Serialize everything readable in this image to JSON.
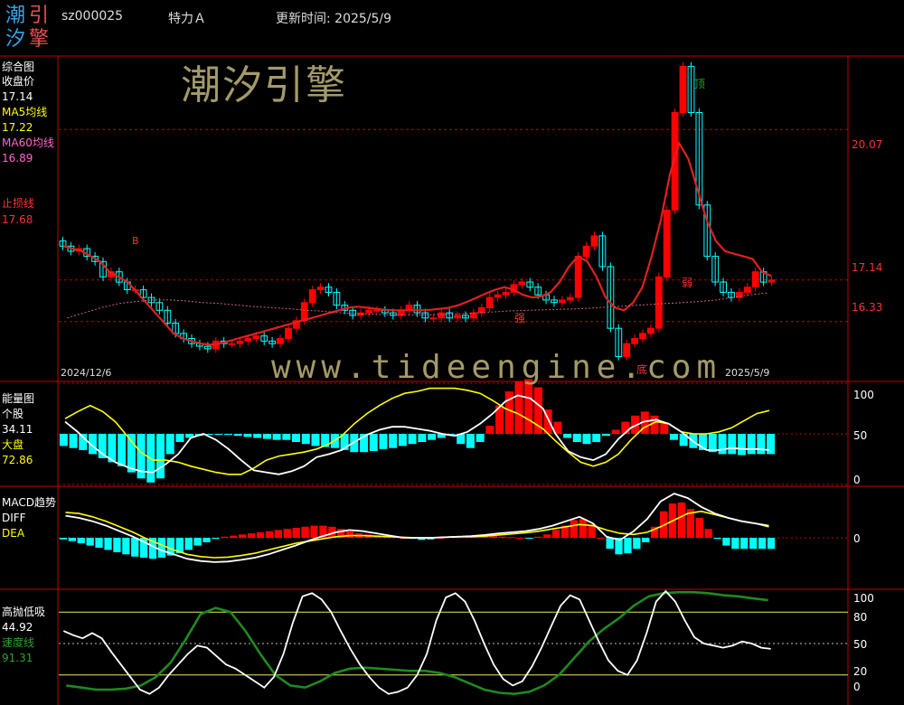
{
  "header": {
    "logo": [
      "潮",
      "引",
      "汐",
      "擎"
    ],
    "code": "sz000025",
    "name": "特力Ａ",
    "update_label": "更新时间: 2025/5/9"
  },
  "watermark": {
    "cn": "潮汐引擎",
    "url": "www.tideengine.com"
  },
  "colors": {
    "up": "#ff0000",
    "down": "#00ffff",
    "yellow": "#ffff00",
    "magenta": "#ff66cc",
    "green": "#1f8a1f",
    "axis_red": "#ff3030"
  },
  "panel1": {
    "title": "综合图",
    "close_label": "收盘价",
    "close_value": "17.14",
    "ma5_label": "MA5均线",
    "ma5_value": "17.22",
    "ma60_label": "MA60均线",
    "ma60_value": "16.89",
    "stop_label": "止损线",
    "stop_value": "17.68",
    "ticks": [
      "20.07",
      "17.14",
      "16.33"
    ],
    "date_start": "2024/12/6",
    "date_end": "2025/5/9",
    "mark_top": "顶",
    "mark_bottom": "底",
    "mark_strong": "强",
    "mark_weak": "弱",
    "mark_b": "B"
  },
  "panel2": {
    "title": "能量图",
    "stock_label": "个股",
    "stock_value": "34.11",
    "market_label": "大盘",
    "market_value": "72.86",
    "ticks": [
      "100",
      "50",
      "0"
    ]
  },
  "panel3": {
    "title": "MACD趋势",
    "diff_label": "DIFF",
    "dea_label": "DEA",
    "ticks": [
      "0"
    ]
  },
  "panel4": {
    "title": "高抛低吸",
    "value": "44.92",
    "speed_label": "速度线",
    "speed_value": "91.31",
    "ticks": [
      "100",
      "80",
      "50",
      "20",
      "0"
    ]
  },
  "chart_data": [
    {
      "type": "candlestick",
      "title": "综合图",
      "x_start": "2024/12/6",
      "x_end": "2025/5/9",
      "ylim": [
        15.2,
        21.5
      ],
      "reference_lines": [
        20.07,
        17.14,
        16.33
      ],
      "close": [
        17.8,
        17.7,
        17.75,
        17.6,
        17.5,
        17.2,
        17.3,
        17.1,
        16.95,
        16.95,
        16.8,
        16.7,
        16.55,
        16.3,
        16.1,
        16.0,
        15.9,
        15.85,
        15.8,
        15.95,
        15.9,
        15.9,
        15.95,
        16.0,
        16.05,
        15.95,
        15.9,
        16.0,
        16.2,
        16.35,
        16.7,
        16.95,
        17.0,
        16.9,
        16.65,
        16.55,
        16.45,
        16.5,
        16.55,
        16.55,
        16.5,
        16.45,
        16.55,
        16.65,
        16.5,
        16.4,
        16.4,
        16.5,
        16.4,
        16.45,
        16.4,
        16.5,
        16.6,
        16.8,
        16.85,
        16.9,
        17.05,
        17.1,
        17.0,
        16.85,
        16.75,
        16.7,
        16.75,
        16.8,
        17.6,
        17.8,
        18.0,
        17.4,
        16.2,
        15.65,
        15.9,
        16.0,
        16.1,
        16.2,
        17.2,
        18.5,
        20.4,
        21.3,
        20.4,
        18.6,
        17.6,
        17.1,
        16.9,
        16.8,
        16.9,
        17.0,
        17.3,
        17.1,
        17.14
      ],
      "ma5": [
        17.8,
        17.75,
        17.7,
        17.6,
        17.5,
        17.3,
        17.2,
        17.1,
        16.9,
        16.7,
        16.5,
        16.3,
        16.1,
        16.0,
        15.95,
        15.9,
        15.88,
        15.9,
        15.95,
        16.0,
        16.05,
        16.1,
        16.15,
        16.2,
        16.25,
        16.3,
        16.35,
        16.4,
        16.45,
        16.5,
        16.55,
        16.6,
        16.62,
        16.6,
        16.58,
        16.56,
        16.55,
        16.55,
        16.55,
        16.55,
        16.56,
        16.58,
        16.6,
        16.65,
        16.72,
        16.8,
        16.88,
        16.95,
        17.0,
        16.95,
        16.85,
        16.8,
        16.82,
        16.9,
        17.1,
        17.4,
        17.6,
        17.5,
        17.2,
        16.8,
        16.6,
        16.55,
        16.7,
        17.0,
        17.6,
        18.3,
        19.2,
        19.8,
        19.5,
        18.9,
        18.3,
        17.9,
        17.7,
        17.65,
        17.6,
        17.55,
        17.3,
        17.22
      ],
      "ma60": [
        16.4,
        16.5,
        16.6,
        16.68,
        16.72,
        16.75,
        16.75,
        16.73,
        16.7,
        16.68,
        16.65,
        16.62,
        16.6,
        16.58,
        16.55,
        16.53,
        16.5,
        16.48,
        16.47,
        16.46,
        16.46,
        16.46,
        16.47,
        16.48,
        16.5,
        16.52,
        16.54,
        16.55,
        16.56,
        16.57,
        16.58,
        16.6,
        16.62,
        16.64,
        16.66,
        16.68,
        16.7,
        16.72,
        16.75,
        16.8,
        16.85,
        16.89
      ]
    },
    {
      "type": "line+bar",
      "title": "能量图",
      "ylim": [
        0,
        100
      ],
      "series": [
        {
          "name": "个股",
          "values": [
            62,
            52,
            40,
            30,
            22,
            17,
            13,
            12,
            20,
            30,
            46,
            50,
            44,
            35,
            24,
            14,
            12,
            10,
            13,
            18,
            27,
            30,
            34,
            42,
            49,
            54,
            57,
            57,
            55,
            53,
            50,
            48,
            52,
            60,
            70,
            82,
            88,
            85,
            75,
            50,
            33,
            27,
            24,
            30,
            45,
            56,
            62,
            64,
            60,
            52,
            42,
            34,
            34,
            36,
            35,
            35,
            34
          ]
        },
        {
          "name": "大盘",
          "values": [
            65,
            72,
            78,
            72,
            62,
            47,
            32,
            24,
            24,
            22,
            18,
            15,
            12,
            10,
            10,
            16,
            24,
            28,
            30,
            32,
            35,
            40,
            48,
            60,
            70,
            78,
            85,
            90,
            92,
            95,
            95,
            95,
            93,
            90,
            83,
            75,
            70,
            63,
            55,
            43,
            32,
            22,
            18,
            22,
            30,
            44,
            56,
            62,
            60,
            52,
            50,
            50,
            52,
            56,
            63,
            70,
            73
          ]
        }
      ],
      "bars": [
        -12,
        -14,
        -16,
        -20,
        -24,
        -28,
        -32,
        -38,
        -44,
        -48,
        -44,
        -20,
        -8,
        -4,
        -2,
        -1,
        -1,
        -1,
        -2,
        -3,
        -4,
        -5,
        -6,
        -6,
        -8,
        -10,
        -12,
        -13,
        -14,
        -16,
        -18,
        -18,
        -17,
        -15,
        -14,
        -12,
        -10,
        -8,
        -6,
        -4,
        -2,
        -10,
        -14,
        -8,
        8,
        28,
        42,
        52,
        54,
        46,
        24,
        12,
        -4,
        -8,
        -10,
        -8,
        -2,
        4,
        12,
        18,
        22,
        18,
        10,
        -6,
        -12,
        -14,
        -16,
        -18,
        -20,
        -20,
        -21,
        -20,
        -20,
        -20
      ]
    },
    {
      "type": "line+bar",
      "title": "MACD趋势",
      "ylim": [
        -0.9,
        0.9
      ],
      "series": [
        {
          "name": "DIFF",
          "values": [
            0.4,
            0.36,
            0.3,
            0.22,
            0.12,
            0.02,
            -0.1,
            -0.22,
            -0.3,
            -0.38,
            -0.42,
            -0.44,
            -0.43,
            -0.4,
            -0.36,
            -0.3,
            -0.22,
            -0.14,
            -0.05,
            0.03,
            0.1,
            0.14,
            0.12,
            0.08,
            0.04,
            0.0,
            0.0,
            0.0,
            0.01,
            0.02,
            0.03,
            0.05,
            0.08,
            0.1,
            0.12,
            0.16,
            0.22,
            0.3,
            0.38,
            0.26,
            0.02,
            -0.04,
            0.12,
            0.34,
            0.66,
            0.8,
            0.72,
            0.56,
            0.44,
            0.36,
            0.3,
            0.26,
            0.22
          ]
        },
        {
          "name": "DEA",
          "values": [
            0.46,
            0.44,
            0.38,
            0.3,
            0.2,
            0.1,
            -0.02,
            -0.12,
            -0.22,
            -0.3,
            -0.34,
            -0.36,
            -0.35,
            -0.32,
            -0.28,
            -0.22,
            -0.16,
            -0.1,
            -0.06,
            -0.02,
            0.02,
            0.04,
            0.04,
            0.03,
            0.02,
            0.01,
            0.0,
            0.0,
            0.01,
            0.02,
            0.02,
            0.03,
            0.05,
            0.07,
            0.09,
            0.12,
            0.16,
            0.2,
            0.24,
            0.22,
            0.14,
            0.08,
            0.06,
            0.1,
            0.2,
            0.32,
            0.44,
            0.48,
            0.42,
            0.36,
            0.3,
            0.26,
            0.2
          ]
        }
      ],
      "bars": [
        -0.03,
        -0.06,
        -0.1,
        -0.14,
        -0.18,
        -0.22,
        -0.26,
        -0.3,
        -0.34,
        -0.36,
        -0.38,
        -0.36,
        -0.32,
        -0.28,
        -0.22,
        -0.14,
        -0.08,
        -0.02,
        0.02,
        0.04,
        0.06,
        0.08,
        0.1,
        0.12,
        0.14,
        0.16,
        0.18,
        0.2,
        0.22,
        0.22,
        0.2,
        0.16,
        0.12,
        0.08,
        0.06,
        0.04,
        0.03,
        0.02,
        0.0,
        -0.02,
        -0.04,
        -0.03,
        0.0,
        0.02,
        0.03,
        0.04,
        0.05,
        0.06,
        0.04,
        0.02,
        0.01,
        0.0,
        -0.01,
        0.02,
        0.06,
        0.14,
        0.22,
        0.32,
        0.34,
        0.24,
        0.0,
        -0.2,
        -0.3,
        -0.28,
        -0.2,
        -0.08,
        0.2,
        0.48,
        0.62,
        0.64,
        0.52,
        0.36,
        0.16,
        -0.02,
        -0.14,
        -0.2,
        -0.2,
        -0.2,
        -0.2,
        -0.2
      ]
    },
    {
      "type": "line",
      "title": "高抛低吸",
      "ylim": [
        0,
        100
      ],
      "reference_lines": [
        80,
        50,
        20
      ],
      "series": [
        {
          "name": "高抛低吸",
          "values": [
            62,
            58,
            55,
            60,
            55,
            42,
            30,
            18,
            6,
            2,
            8,
            20,
            30,
            40,
            48,
            46,
            38,
            30,
            26,
            20,
            14,
            8,
            18,
            40,
            70,
            95,
            98,
            92,
            80,
            62,
            45,
            30,
            18,
            8,
            2,
            4,
            8,
            20,
            40,
            72,
            94,
            98,
            90,
            72,
            50,
            30,
            16,
            10,
            14,
            28,
            46,
            66,
            86,
            96,
            92,
            72,
            52,
            34,
            24,
            20,
            34,
            60,
            90,
            100,
            90,
            72,
            56,
            50,
            48,
            46,
            48,
            52,
            50,
            46,
            44.92
          ]
        },
        {
          "name": "速度线",
          "values": [
            10,
            8,
            6,
            6,
            7,
            10,
            18,
            32,
            54,
            78,
            84,
            80,
            62,
            40,
            20,
            10,
            8,
            14,
            22,
            26,
            27,
            26,
            25,
            24,
            24,
            22,
            18,
            12,
            6,
            3,
            2,
            4,
            10,
            20,
            36,
            52,
            64,
            74,
            86,
            95,
            98,
            99,
            99,
            98,
            96,
            95,
            93,
            91.31
          ]
        }
      ]
    }
  ]
}
